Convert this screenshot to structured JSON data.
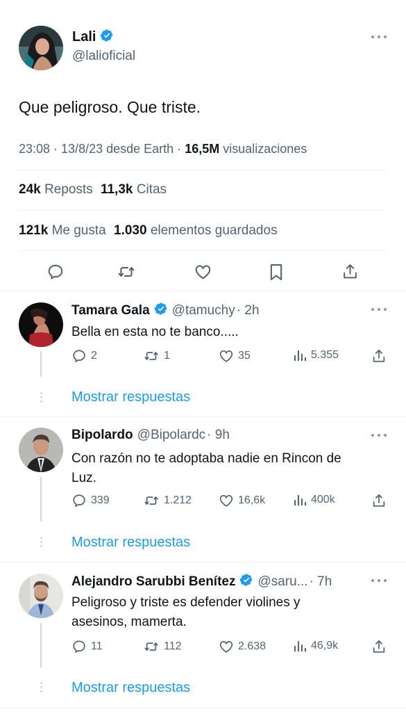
{
  "main_tweet": {
    "author_name": "Lali",
    "author_handle": "@lalioficial",
    "text": "Que peligroso. Que triste.",
    "meta": {
      "time_date": "23:08 · 13/8/23 desde Earth ·",
      "views_count": "16,5M",
      "views_label": "visualizaciones"
    },
    "stats_row1": {
      "reposts_count": "24k",
      "reposts_label": "Reposts",
      "quotes_count": "11,3k",
      "quotes_label": "Citas"
    },
    "stats_row2": {
      "likes_count": "121k",
      "likes_label": "Me gusta",
      "bookmarks_count": "1.030",
      "bookmarks_label": "elementos guardados"
    }
  },
  "replies": [
    {
      "name": "Tamara Gala",
      "handle": "@tamuchy",
      "time": "· 2h",
      "text_lines": [
        "Bella en esta no te banco....."
      ],
      "replies": "2",
      "reposts": "1",
      "likes": "35",
      "views": "5.355",
      "show_replies": "Mostrar respuestas"
    },
    {
      "name": "Bipolardo",
      "handle": "@Bipolardc",
      "time": "· 9h",
      "text_lines": [
        "Con razón no te adoptaba nadie en Rincon de",
        "Luz."
      ],
      "replies": "339",
      "reposts": "1.212",
      "likes": "16,6k",
      "views": "400k",
      "show_replies": "Mostrar respuestas"
    },
    {
      "name": "Alejandro Sarubbi Benítez",
      "handle": "@saru...",
      "time": "· 7h",
      "text_lines": [
        "Peligroso y triste es defender violines y",
        "asesinos, mamerta."
      ],
      "replies": "11",
      "reposts": "112",
      "likes": "2.638",
      "views": "46,9k",
      "show_replies": "Mostrar respuestas"
    }
  ],
  "colors": {
    "verified": "#1d9bf0",
    "link": "#1d9bf0",
    "text": "#0f1419",
    "muted": "#536471"
  },
  "icons": [
    "reply-icon",
    "repost-icon",
    "like-icon",
    "bookmark-icon",
    "share-icon",
    "views-icon",
    "verified-badge-icon",
    "more-icon"
  ]
}
